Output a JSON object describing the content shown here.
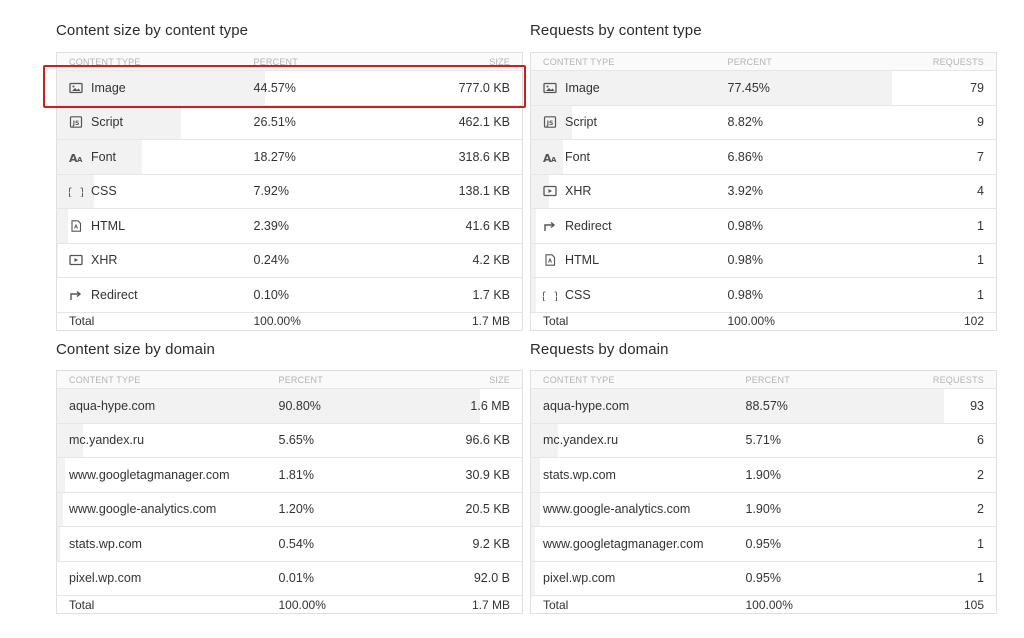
{
  "content_type_size": {
    "title": "Content size by content type",
    "headers": [
      "CONTENT TYPE",
      "PERCENT",
      "SIZE"
    ],
    "rows": [
      {
        "name": "Image",
        "icon": "image-icon",
        "percent": "44.57%",
        "value": "777.0 KB",
        "share": 0.4457
      },
      {
        "name": "Script",
        "icon": "script-icon",
        "percent": "26.51%",
        "value": "462.1 KB",
        "share": 0.2651
      },
      {
        "name": "Font",
        "icon": "font-icon",
        "percent": "18.27%",
        "value": "318.6 KB",
        "share": 0.1827
      },
      {
        "name": "CSS",
        "icon": "css-icon",
        "percent": "7.92%",
        "value": "138.1 KB",
        "share": 0.0792
      },
      {
        "name": "HTML",
        "icon": "html-icon",
        "percent": "2.39%",
        "value": "41.6 KB",
        "share": 0.0239
      },
      {
        "name": "XHR",
        "icon": "xhr-icon",
        "percent": "0.24%",
        "value": "4.2 KB",
        "share": 0.0024
      },
      {
        "name": "Redirect",
        "icon": "redirect-icon",
        "percent": "0.10%",
        "value": "1.7 KB",
        "share": 0.001
      }
    ],
    "total": {
      "label": "Total",
      "percent": "100.00%",
      "value": "1.7 MB"
    }
  },
  "content_type_requests": {
    "title": "Requests by content type",
    "headers": [
      "CONTENT TYPE",
      "PERCENT",
      "REQUESTS"
    ],
    "rows": [
      {
        "name": "Image",
        "icon": "image-icon",
        "percent": "77.45%",
        "value": "79",
        "share": 0.7745
      },
      {
        "name": "Script",
        "icon": "script-icon",
        "percent": "8.82%",
        "value": "9",
        "share": 0.0882
      },
      {
        "name": "Font",
        "icon": "font-icon",
        "percent": "6.86%",
        "value": "7",
        "share": 0.0686
      },
      {
        "name": "XHR",
        "icon": "xhr-icon",
        "percent": "3.92%",
        "value": "4",
        "share": 0.0392
      },
      {
        "name": "Redirect",
        "icon": "redirect-icon",
        "percent": "0.98%",
        "value": "1",
        "share": 0.0098
      },
      {
        "name": "HTML",
        "icon": "html-icon",
        "percent": "0.98%",
        "value": "1",
        "share": 0.0098
      },
      {
        "name": "CSS",
        "icon": "css-icon",
        "percent": "0.98%",
        "value": "1",
        "share": 0.0098
      }
    ],
    "total": {
      "label": "Total",
      "percent": "100.00%",
      "value": "102"
    }
  },
  "domain_size": {
    "title": "Content size by domain",
    "headers": [
      "CONTENT TYPE",
      "PERCENT",
      "SIZE"
    ],
    "rows": [
      {
        "name": "aqua-hype.com",
        "percent": "90.80%",
        "value": "1.6 MB",
        "share": 0.908
      },
      {
        "name": "mc.yandex.ru",
        "percent": "5.65%",
        "value": "96.6 KB",
        "share": 0.0565
      },
      {
        "name": "www.googletagmanager.com",
        "percent": "1.81%",
        "value": "30.9 KB",
        "share": 0.0181
      },
      {
        "name": "www.google-analytics.com",
        "percent": "1.20%",
        "value": "20.5 KB",
        "share": 0.012
      },
      {
        "name": "stats.wp.com",
        "percent": "0.54%",
        "value": "9.2 KB",
        "share": 0.0054
      },
      {
        "name": "pixel.wp.com",
        "percent": "0.01%",
        "value": "92.0 B",
        "share": 0.0001
      }
    ],
    "total": {
      "label": "Total",
      "percent": "100.00%",
      "value": "1.7 MB"
    }
  },
  "domain_requests": {
    "title": "Requests by domain",
    "headers": [
      "CONTENT TYPE",
      "PERCENT",
      "REQUESTS"
    ],
    "rows": [
      {
        "name": "aqua-hype.com",
        "percent": "88.57%",
        "value": "93",
        "share": 0.8857
      },
      {
        "name": "mc.yandex.ru",
        "percent": "5.71%",
        "value": "6",
        "share": 0.0571
      },
      {
        "name": "stats.wp.com",
        "percent": "1.90%",
        "value": "2",
        "share": 0.019
      },
      {
        "name": "www.google-analytics.com",
        "percent": "1.90%",
        "value": "2",
        "share": 0.019
      },
      {
        "name": "www.googletagmanager.com",
        "percent": "0.95%",
        "value": "1",
        "share": 0.0095
      },
      {
        "name": "pixel.wp.com",
        "percent": "0.95%",
        "value": "1",
        "share": 0.0095
      }
    ],
    "total": {
      "label": "Total",
      "percent": "100.00%",
      "value": "105"
    }
  },
  "colors": {
    "highlight": "#cc1f1f",
    "bar": "#f2f2f2",
    "border": "#e0e0e0"
  }
}
